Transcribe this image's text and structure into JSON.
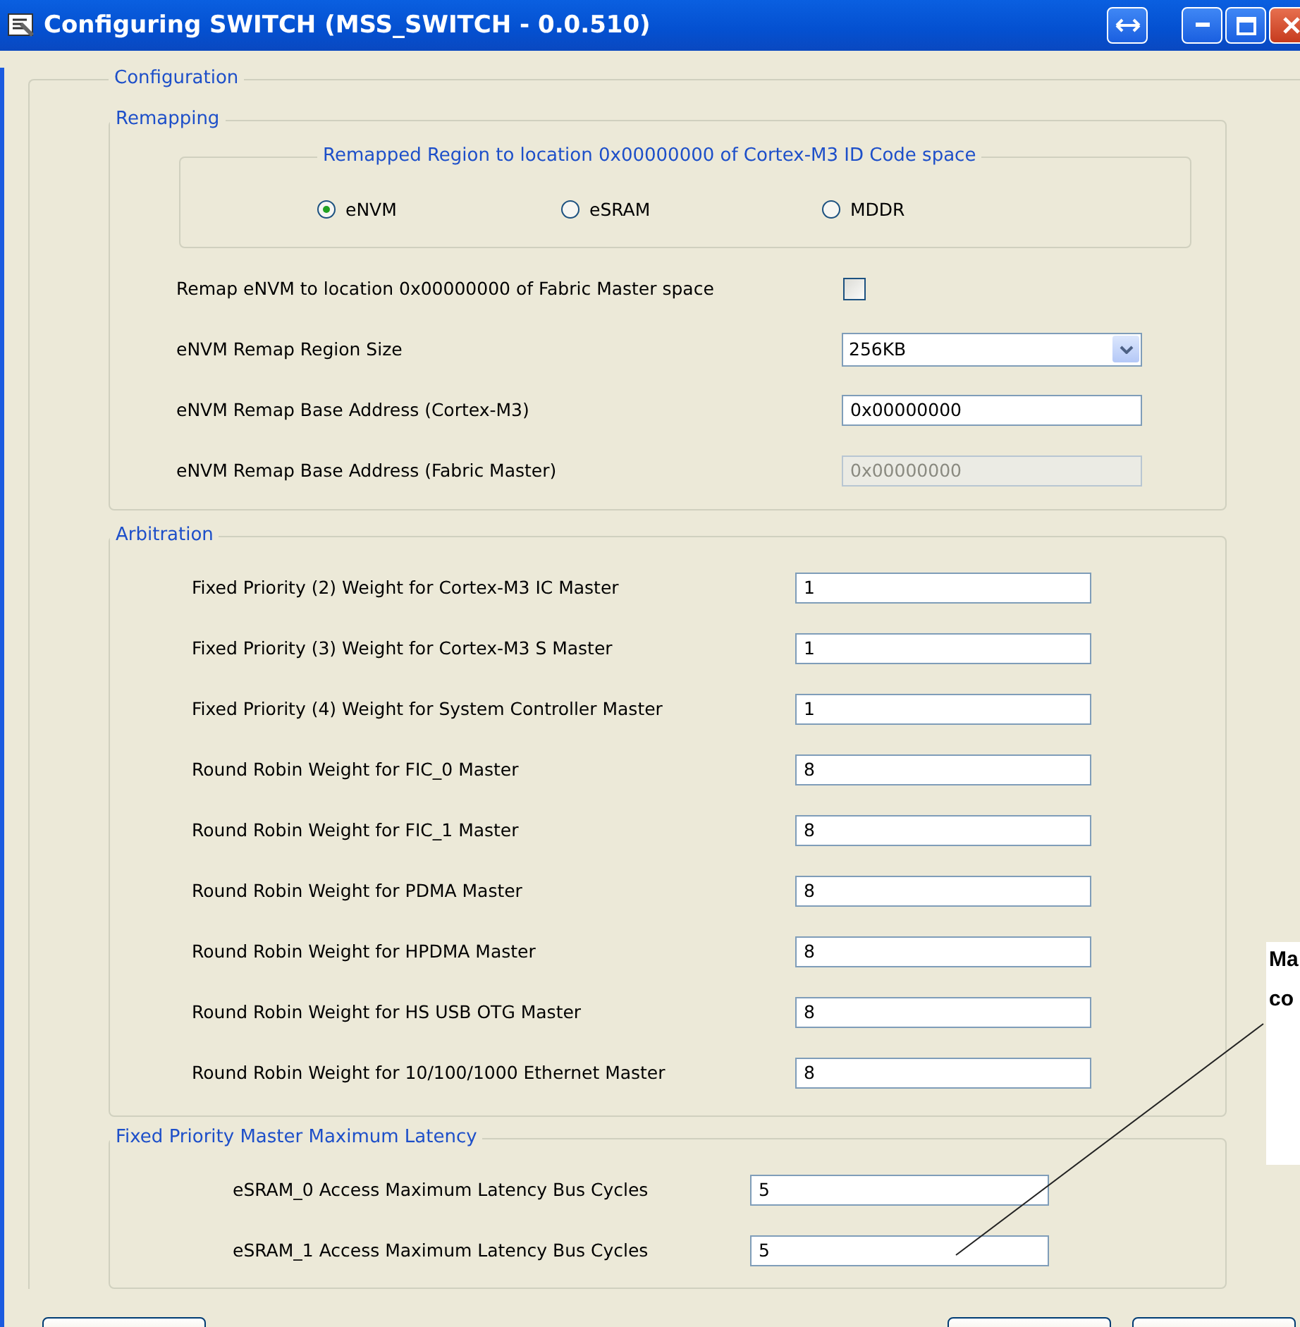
{
  "window": {
    "title": "Configuring SWITCH (MSS_SWITCH - 0.0.510)"
  },
  "configuration": {
    "legend": "Configuration",
    "remapping": {
      "legend": "Remapping",
      "region": {
        "legend": "Remapped Region to location 0x00000000 of Cortex-M3 ID Code space",
        "options": [
          {
            "label": "eNVM",
            "selected": true
          },
          {
            "label": "eSRAM",
            "selected": false
          },
          {
            "label": "MDDR",
            "selected": false
          }
        ]
      },
      "fields": [
        {
          "kind": "checkbox",
          "label": "Remap eNVM to location 0x00000000 of Fabric Master space",
          "checked": false
        },
        {
          "kind": "dropdown",
          "label": "eNVM Remap Region Size",
          "value": "256KB"
        },
        {
          "kind": "text",
          "label": "eNVM Remap Base Address (Cortex-M3)",
          "value": "0x00000000",
          "disabled": false
        },
        {
          "kind": "text",
          "label": "eNVM Remap Base Address (Fabric Master)",
          "value": "0x00000000",
          "disabled": true
        }
      ]
    },
    "arbitration": {
      "legend": "Arbitration",
      "fields": [
        {
          "label": "Fixed Priority (2) Weight for Cortex-M3 IC Master",
          "value": "1"
        },
        {
          "label": "Fixed Priority (3) Weight for Cortex-M3 S Master",
          "value": "1"
        },
        {
          "label": "Fixed Priority (4) Weight for System Controller Master",
          "value": "1"
        },
        {
          "label": "Round Robin Weight for FIC_0 Master",
          "value": "8"
        },
        {
          "label": "Round Robin Weight for FIC_1 Master",
          "value": "8"
        },
        {
          "label": "Round Robin Weight for PDMA Master",
          "value": "8"
        },
        {
          "label": "Round Robin Weight for HPDMA Master",
          "value": "8"
        },
        {
          "label": "Round Robin Weight for HS USB OTG Master",
          "value": "8"
        },
        {
          "label": "Round Robin Weight for 10/100/1000 Ethernet Master",
          "value": "8"
        }
      ]
    },
    "latency": {
      "legend": "Fixed Priority Master Maximum Latency",
      "fields": [
        {
          "label": "eSRAM_0 Access Maximum Latency Bus Cycles",
          "value": "5"
        },
        {
          "label": "eSRAM_1 Access Maximum Latency Bus Cycles",
          "value": "5"
        }
      ]
    }
  },
  "callout": {
    "lines": [
      "Ma",
      "co"
    ]
  }
}
